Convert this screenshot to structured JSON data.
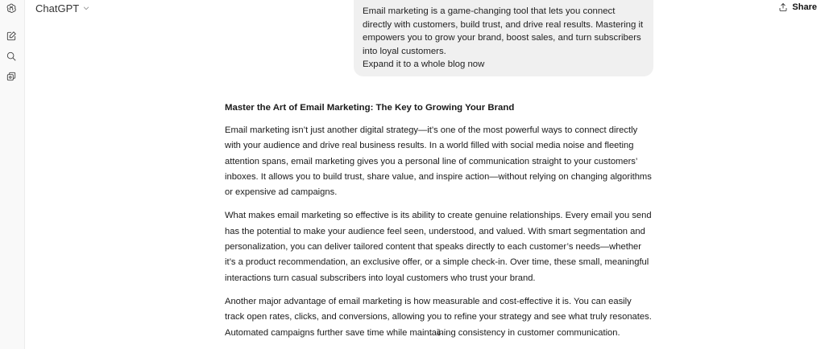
{
  "header": {
    "model_name": "ChatGPT",
    "share_label": "Share"
  },
  "sidebar": {
    "icons": [
      "openai-logo-icon",
      "new-chat-icon",
      "search-icon",
      "library-icon"
    ]
  },
  "user_message": {
    "text": "Email marketing is a game-changing tool that lets you connect directly with customers, build trust, and drive real results. Mastering it empowers you to grow your brand, boost sales, and turn subscribers into loyal customers.\nExpand it to a whole blog now"
  },
  "assistant_message": {
    "title": "Master the Art of Email Marketing: The Key to Growing Your Brand",
    "paragraphs": [
      "Email marketing isn’t just another digital strategy—it’s one of the most powerful ways to connect directly with your audience and drive real business results. In a world filled with social media noise and fleeting attention spans, email marketing gives you a personal line of communication straight to your customers’ inboxes. It allows you to build trust, share value, and inspire action—without relying on changing algorithms or expensive ad campaigns.",
      "What makes email marketing so effective is its ability to create genuine relationships. Every email you send has the potential to make your audience feel seen, understood, and valued. With smart segmentation and personalization, you can deliver tailored content that speaks directly to each customer’s needs—whether it’s a product recommendation, an exclusive offer, or a simple check-in. Over time, these small, meaningful interactions turn casual subscribers into loyal customers who trust your brand.",
      "Another major advantage of email marketing is how measurable and cost-effective it is. You can easily track open rates, clicks, and conversions, allowing you to refine your strategy and see what truly resonates. Automated campaigns further save time while maintaining consistency in customer communication."
    ]
  }
}
